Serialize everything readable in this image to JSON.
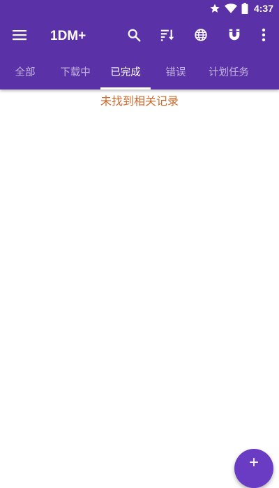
{
  "status_bar": {
    "time": "4:37",
    "icons": [
      "star-icon",
      "wifi-icon",
      "battery-icon"
    ]
  },
  "toolbar": {
    "title": "1DM+",
    "actions": [
      "search-icon",
      "sort-icon",
      "browser-globe-icon",
      "magnet-icon",
      "more-vert-icon"
    ]
  },
  "tabs": [
    {
      "label": "全部"
    },
    {
      "label": "下载中"
    },
    {
      "label": "已完成",
      "active": true
    },
    {
      "label": "错误"
    },
    {
      "label": "计划任务"
    }
  ],
  "content": {
    "empty_message": "未找到相关记录"
  },
  "colors": {
    "appbar": "#5b31a8",
    "accent": "#6a3cc4",
    "empty_message": "#d06a2c"
  }
}
